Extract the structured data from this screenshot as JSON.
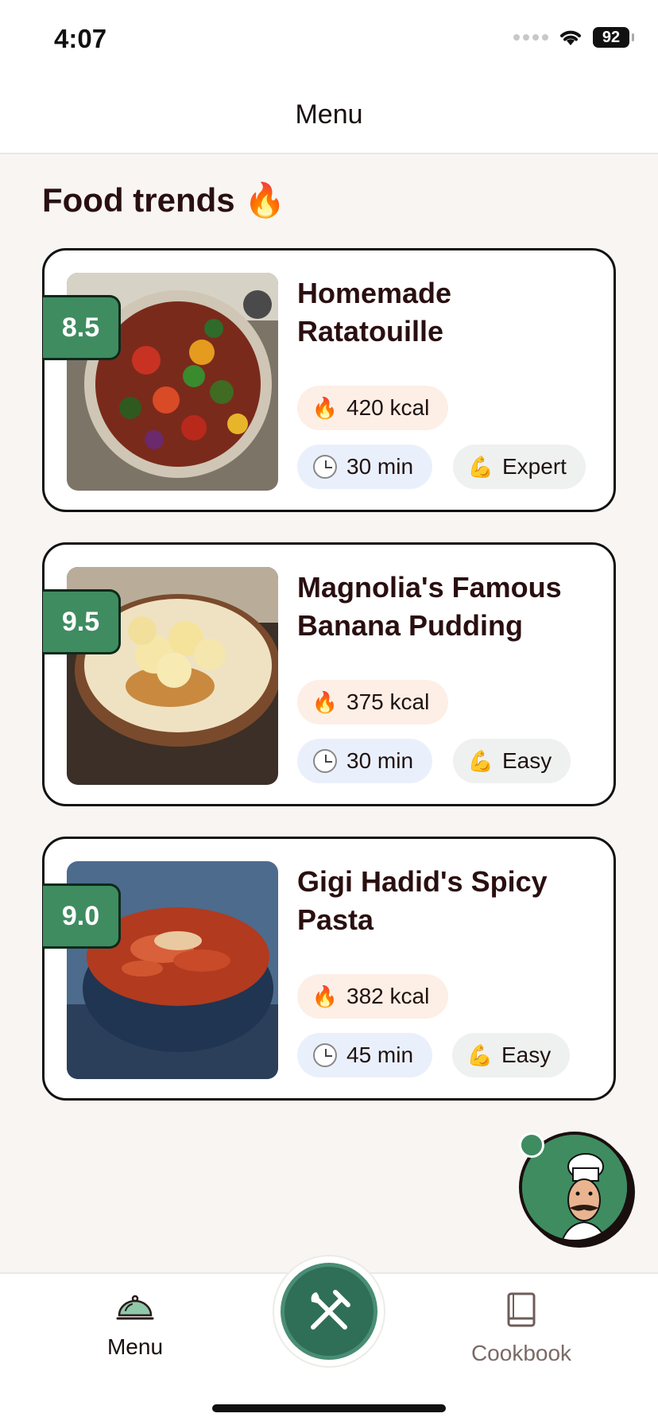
{
  "status": {
    "time": "4:07",
    "battery": "92"
  },
  "nav": {
    "title": "Menu"
  },
  "section": {
    "title": "Food trends",
    "emoji": "🔥"
  },
  "recipes": [
    {
      "score": "8.5",
      "title": "Homemade Ratatouille",
      "kcal": "420 kcal",
      "time": "30 min",
      "difficulty": "Expert",
      "image": "ratatouille-bowl"
    },
    {
      "score": "9.5",
      "title": "Magnolia's Famous Banana Pudding",
      "kcal": "375 kcal",
      "time": "30 min",
      "difficulty": "Easy",
      "image": "banana-pudding-bowl"
    },
    {
      "score": "9.0",
      "title": "Gigi Hadid's Spicy Pasta",
      "kcal": "382 kcal",
      "time": "45 min",
      "difficulty": "Easy",
      "image": "spicy-pasta-bowl"
    }
  ],
  "icons": {
    "kcal": "🔥",
    "time": "clock-icon",
    "difficulty": "💪"
  },
  "tabs": {
    "menu": "Menu",
    "cookbook": "Cookbook"
  },
  "colors": {
    "accent": "#3f8c61",
    "fab": "#2f6f58",
    "text": "#2a0f10"
  }
}
